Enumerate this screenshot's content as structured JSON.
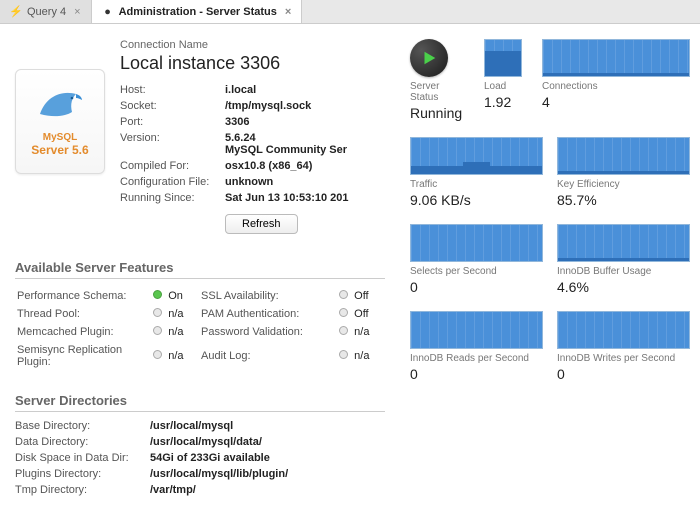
{
  "tabs": [
    {
      "label": "Query 4",
      "icon": "⚡"
    },
    {
      "label": "Administration - Server Status",
      "icon": "●"
    }
  ],
  "connection": {
    "name_label": "Connection Name",
    "name": "Local instance 3306",
    "host_label": "Host:",
    "host": "i.local",
    "socket_label": "Socket:",
    "socket": "/tmp/mysql.sock",
    "port_label": "Port:",
    "port": "3306",
    "version_label": "Version:",
    "version": "5.6.24",
    "version_sub": "MySQL Community Ser",
    "compiled_label": "Compiled For:",
    "compiled": "osx10.8   (x86_64)",
    "config_label": "Configuration File:",
    "config": "unknown",
    "running_label": "Running Since:",
    "running": "Sat Jun 13 10:53:10 201",
    "refresh": "Refresh"
  },
  "logo": {
    "name": "MySQL",
    "version": "Server 5.6"
  },
  "features_header": "Available Server Features",
  "features": {
    "perf_schema_label": "Performance Schema:",
    "perf_schema_val": "On",
    "ssl_label": "SSL Availability:",
    "ssl_val": "Off",
    "thread_pool_label": "Thread Pool:",
    "thread_pool_val": "n/a",
    "pam_label": "PAM Authentication:",
    "pam_val": "Off",
    "memcached_label": "Memcached Plugin:",
    "memcached_val": "n/a",
    "password_label": "Password Validation:",
    "password_val": "n/a",
    "semisync_label": "Semisync Replication Plugin:",
    "semisync_val": "n/a",
    "audit_label": "Audit Log:",
    "audit_val": "n/a"
  },
  "dirs_header": "Server Directories",
  "dirs": {
    "base_label": "Base Directory:",
    "base": "/usr/local/mysql",
    "data_label": "Data Directory:",
    "data": "/usr/local/mysql/data/",
    "disk_label": "Disk Space in Data Dir:",
    "disk": "54Gi of 233Gi available",
    "plugins_label": "Plugins Directory:",
    "plugins": "/usr/local/mysql/lib/plugin/",
    "tmp_label": "Tmp Directory:",
    "tmp": "/var/tmp/"
  },
  "stats": {
    "server_status_label": "Server Status",
    "server_status": "Running",
    "load_label": "Load",
    "load": "1.92",
    "connections_label": "Connections",
    "connections": "4",
    "traffic_label": "Traffic",
    "traffic": "9.06 KB/s",
    "key_eff_label": "Key Efficiency",
    "key_eff": "85.7%",
    "selects_label": "Selects per Second",
    "selects": "0",
    "buffer_label": "InnoDB Buffer Usage",
    "buffer": "4.6%",
    "reads_label": "InnoDB Reads per Second",
    "reads": "0",
    "writes_label": "InnoDB Writes per Second",
    "writes": "0"
  }
}
